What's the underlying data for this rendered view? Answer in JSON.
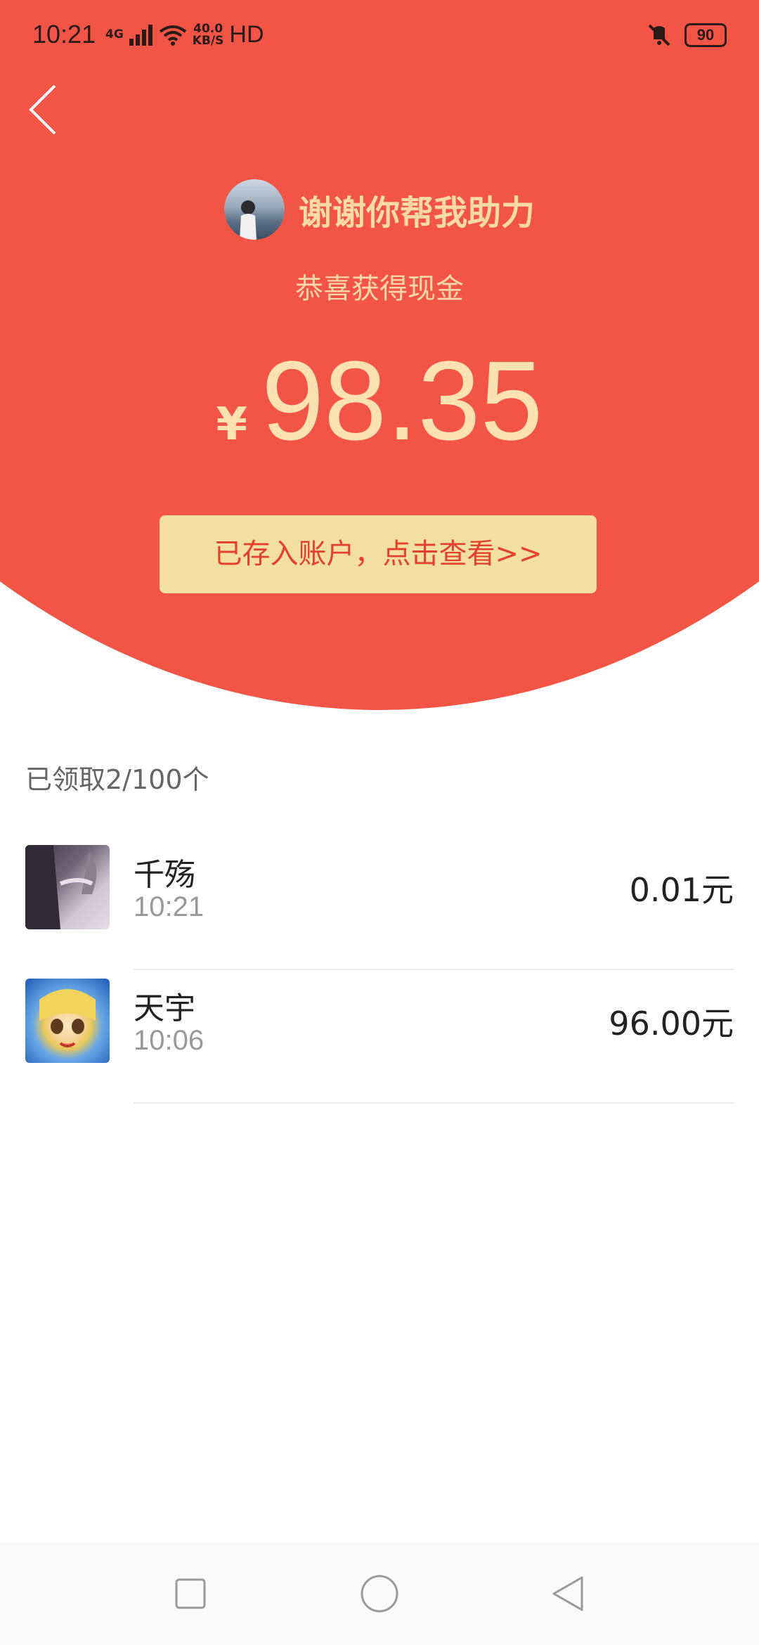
{
  "status_bar": {
    "time": "10:21",
    "network_type": "4G",
    "net_speed_value": "40.0",
    "net_speed_unit": "KB/S",
    "hd_label": "HD",
    "battery": "90"
  },
  "header": {
    "sender_name": "谢谢你帮我助力",
    "subtitle": "恭喜获得现金",
    "currency_symbol": "¥",
    "amount": "98.35",
    "view_button_label": "已存入账户，点击查看>>"
  },
  "summary": {
    "text": "已领取2/100个"
  },
  "records": [
    {
      "name": "千殇",
      "time": "10:21",
      "amount": "0.01元"
    },
    {
      "name": "天宇",
      "time": "10:06",
      "amount": "96.00元"
    }
  ],
  "colors": {
    "header_red": "#f25545",
    "gold_text": "#fbe2b0",
    "button_bg": "#f3dfa2",
    "button_text": "#e4402e"
  },
  "icons": {
    "back": "chevron-left-icon",
    "nav_recent": "square-icon",
    "nav_home": "circle-icon",
    "nav_back": "triangle-back-icon"
  }
}
